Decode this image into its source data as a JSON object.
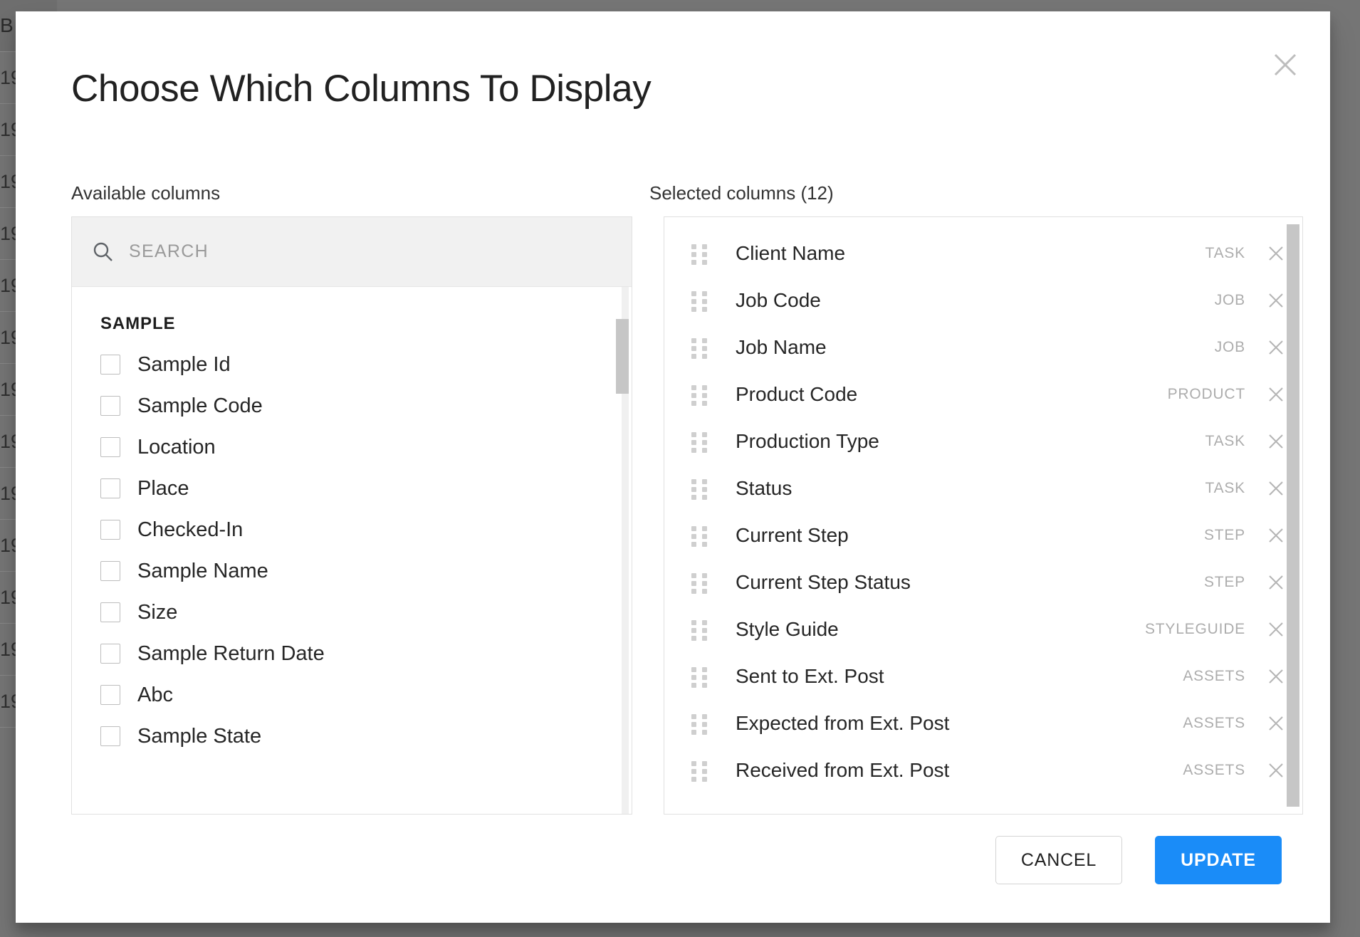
{
  "backdrop": {
    "header_cell": "B",
    "rows": [
      "19",
      "19",
      "19",
      "19",
      "19",
      "19",
      "19",
      "19",
      "19",
      "19",
      "19",
      "19",
      "19"
    ]
  },
  "dialog": {
    "title": "Choose Which Columns To Display",
    "close_icon": "close-icon"
  },
  "available": {
    "label": "Available columns",
    "search": {
      "placeholder": "SEARCH",
      "value": "",
      "icon": "search-icon"
    },
    "groups": [
      {
        "title": "SAMPLE",
        "items": [
          {
            "label": "Sample Id",
            "checked": false
          },
          {
            "label": "Sample Code",
            "checked": false
          },
          {
            "label": "Location",
            "checked": false
          },
          {
            "label": "Place",
            "checked": false
          },
          {
            "label": "Checked-In",
            "checked": false
          },
          {
            "label": "Sample Name",
            "checked": false
          },
          {
            "label": "Size",
            "checked": false
          },
          {
            "label": "Sample Return Date",
            "checked": false
          },
          {
            "label": "Abc",
            "checked": false
          },
          {
            "label": "Sample State",
            "checked": false
          }
        ]
      }
    ]
  },
  "selected": {
    "label": "Selected columns (12)",
    "count": 12,
    "items": [
      {
        "label": "Client Name",
        "tag": "TASK"
      },
      {
        "label": "Job Code",
        "tag": "JOB"
      },
      {
        "label": "Job Name",
        "tag": "JOB"
      },
      {
        "label": "Product Code",
        "tag": "PRODUCT"
      },
      {
        "label": "Production Type",
        "tag": "TASK"
      },
      {
        "label": "Status",
        "tag": "TASK"
      },
      {
        "label": "Current Step",
        "tag": "STEP"
      },
      {
        "label": "Current Step Status",
        "tag": "STEP"
      },
      {
        "label": "Style Guide",
        "tag": "STYLEGUIDE"
      },
      {
        "label": "Sent to Ext. Post",
        "tag": "ASSETS"
      },
      {
        "label": "Expected from Ext. Post",
        "tag": "ASSETS"
      },
      {
        "label": "Received from Ext. Post",
        "tag": "ASSETS"
      }
    ]
  },
  "footer": {
    "cancel_label": "CANCEL",
    "update_label": "UPDATE"
  },
  "colors": {
    "accent": "#1a8cf8",
    "overlay": "#757575",
    "tag_text": "#adadad",
    "border": "#e0e0e0"
  }
}
